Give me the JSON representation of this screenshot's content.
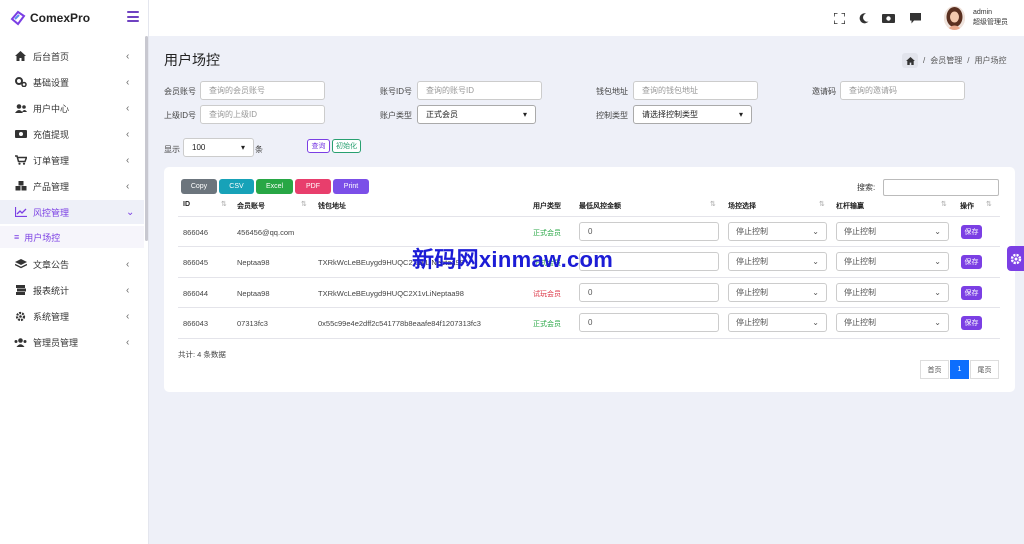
{
  "app": {
    "name": "ComexPro"
  },
  "sidebar": {
    "items": [
      {
        "label": "后台首页",
        "icon": "home-icon"
      },
      {
        "label": "基础设置",
        "icon": "cogs-icon"
      },
      {
        "label": "用户中心",
        "icon": "users-icon"
      },
      {
        "label": "充值提现",
        "icon": "money-icon"
      },
      {
        "label": "订单管理",
        "icon": "cart-icon"
      },
      {
        "label": "产品管理",
        "icon": "cubes-icon"
      },
      {
        "label": "风控管理",
        "icon": "chart-line-icon"
      },
      {
        "label": "文章公告",
        "icon": "layers-icon"
      },
      {
        "label": "报表统计",
        "icon": "book-icon"
      },
      {
        "label": "系统管理",
        "icon": "gear-icon"
      },
      {
        "label": "管理员管理",
        "icon": "user-group-icon"
      }
    ],
    "sub_item": {
      "label": "用户场控"
    }
  },
  "header": {
    "user_name": "admin",
    "user_role": "超级管理员"
  },
  "page": {
    "title": "用户场控",
    "breadcrumb": [
      "会员管理",
      "用户场控"
    ]
  },
  "filters": {
    "member_account": {
      "label": "会员账号",
      "placeholder": "查询的会员账号"
    },
    "account_id": {
      "label": "账号ID号",
      "placeholder": "查询的账号ID"
    },
    "wallet": {
      "label": "钱包地址",
      "placeholder": "查询的钱包地址"
    },
    "invite": {
      "label": "邀请码",
      "placeholder": "查询的邀请码"
    },
    "parent_id": {
      "label": "上级ID号",
      "placeholder": "查询的上级ID"
    },
    "account_type": {
      "label": "账户类型",
      "value": "正式会员"
    },
    "control_type": {
      "label": "控制类型",
      "value": "请选择控制类型"
    },
    "show_label": "显示",
    "show_value": "100",
    "show_unit": "条",
    "query_btn": "查询",
    "reset_btn": "初始化"
  },
  "export": [
    "Copy",
    "CSV",
    "Excel",
    "PDF",
    "Print"
  ],
  "colors": {
    "copy": "#6c757d",
    "csv": "#17a2b8",
    "excel": "#28a745",
    "pdf": "#e83e6c",
    "print": "#7b4fe8",
    "accent": "#7b3fe4"
  },
  "table": {
    "search_label": "搜索:",
    "columns": [
      "ID",
      "会员账号",
      "钱包地址",
      "用户类型",
      "最低风控金额",
      "场控选择",
      "杠杆输赢",
      "操作"
    ],
    "rows": [
      {
        "id": "866046",
        "account": "456456@qq.com",
        "wallet": "",
        "type": "正式会员",
        "type_color": "#28a745",
        "amount": "0",
        "control": "停止控制",
        "leverage": "停止控制",
        "action": "保存"
      },
      {
        "id": "866045",
        "account": "Neptaa98",
        "wallet": "TXRkWcLeBEuygd9HUQC2X1vLiNeptaa98",
        "type": "正式会员",
        "type_color": "#28a745",
        "amount": "0",
        "control": "停止控制",
        "leverage": "停止控制",
        "action": "保存"
      },
      {
        "id": "866044",
        "account": "Neptaa98",
        "wallet": "TXRkWcLeBEuygd9HUQC2X1vLiNeptaa98",
        "type": "试玩会员",
        "type_color": "#dc3545",
        "amount": "0",
        "control": "停止控制",
        "leverage": "停止控制",
        "action": "保存"
      },
      {
        "id": "866043",
        "account": "07313fc3",
        "wallet": "0x55c99e4e2dff2c541778b8eaafe84f1207313fc3",
        "type": "正式会员",
        "type_color": "#28a745",
        "amount": "0",
        "control": "停止控制",
        "leverage": "停止控制",
        "action": "保存"
      }
    ],
    "total": "共计: 4 条数据",
    "pager": {
      "first": "首页",
      "current": "1",
      "last": "尾页"
    }
  },
  "watermark": "新码网xinmaw.com"
}
